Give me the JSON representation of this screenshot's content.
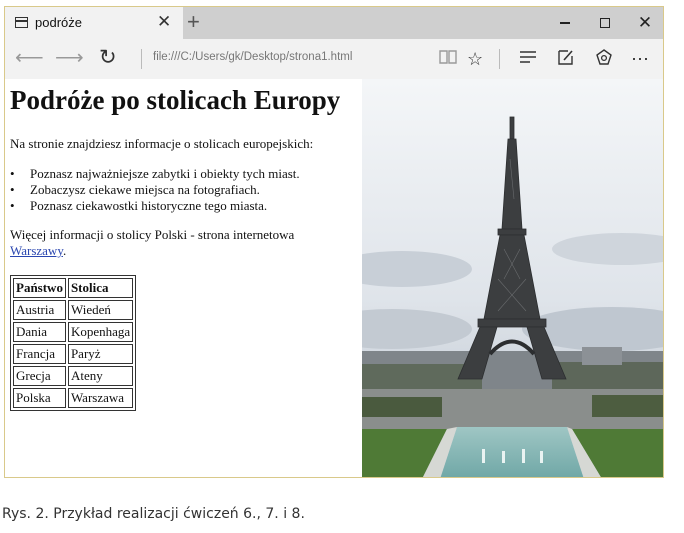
{
  "browser": {
    "tab_title": "podróże",
    "tab_close": "✕",
    "new_tab": "+",
    "address": "file:///C:/Users/gk/Desktop/strona1.html",
    "window_controls": {
      "minimize": "minimize",
      "maximize": "maximize",
      "close": "✕"
    }
  },
  "page": {
    "title": "Podróże po stolicach Europy",
    "intro": "Na stronie znajdziesz informacje o stolicach europejskich:",
    "bullets": [
      "Poznasz najważniejsze zabytki i obiekty tych miast.",
      "Zobaczysz ciekawe miejsca na fotografiach.",
      "Poznasz ciekawostki historyczne tego miasta."
    ],
    "more_text": "Więcej informacji o stolicy Polski - strona internetowa",
    "more_link": "Warszawy",
    "more_after": ".",
    "table": {
      "headers": [
        "Państwo",
        "Stolica"
      ],
      "rows": [
        [
          "Austria",
          "Wiedeń"
        ],
        [
          "Dania",
          "Kopenhaga"
        ],
        [
          "Francja",
          "Paryż"
        ],
        [
          "Grecja",
          "Ateny"
        ],
        [
          "Polska",
          "Warszawa"
        ]
      ]
    }
  },
  "caption": "Rys. 2. Przykład realizacji ćwiczeń 6., 7. i 8.",
  "colors": {
    "link": "#2a46b0",
    "tab_active": "#f2f2f2",
    "titlebar": "#cfcfcf"
  }
}
